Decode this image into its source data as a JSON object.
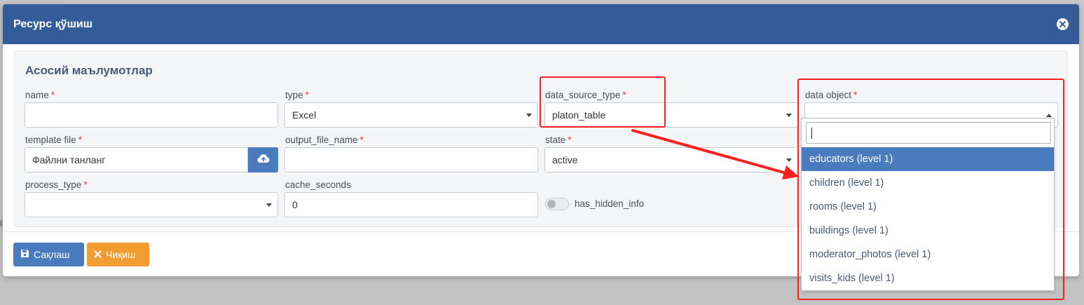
{
  "background": {
    "fragment1": "",
    "fragment2": "р",
    "chevron": "⌄"
  },
  "modal": {
    "title": "Ресурс қўшиш",
    "section_title": "Асосий маълумотлар",
    "fields": {
      "name": {
        "label": "name",
        "value": ""
      },
      "type": {
        "label": "type",
        "value": "Excel"
      },
      "data_source_type": {
        "label": "data_source_type",
        "value": "platon_table"
      },
      "data_object": {
        "label": "data object",
        "value": ""
      },
      "template_file": {
        "label": "template file",
        "value": "Файлни танланг"
      },
      "output_file_name": {
        "label": "output_file_name",
        "value": ""
      },
      "state": {
        "label": "state",
        "value": "active"
      },
      "process_type": {
        "label": "process_type",
        "value": ""
      },
      "cache_seconds": {
        "label": "cache_seconds",
        "value": "0"
      },
      "has_hidden_info": {
        "label": "has_hidden_info"
      }
    },
    "required_mark": "*",
    "buttons": {
      "save": "Сақлаш",
      "exit": "Чиқиш"
    }
  },
  "dropdown": {
    "search_value": "",
    "options": [
      "educators (level 1)",
      "children (level 1)",
      "rooms (level 1)",
      "buildings (level 1)",
      "moderator_photos (level 1)",
      "visits_kids (level 1)"
    ],
    "active_index": 0
  },
  "colors": {
    "header": "#345c9b",
    "primary": "#4b7bbf",
    "warning": "#f39c32",
    "annotation": "#ff1f1f",
    "required": "#e53935"
  },
  "icons": {
    "close": "close-icon",
    "upload": "cloud-upload-icon",
    "save": "save-icon",
    "exit": "x-icon"
  }
}
